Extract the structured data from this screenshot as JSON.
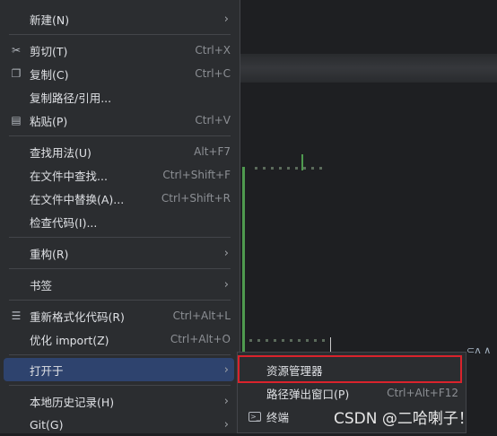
{
  "menu": {
    "items": [
      {
        "label": "新建(N)",
        "shortcut": "",
        "icon": "",
        "submenu": true
      },
      {
        "label": "剪切(T)",
        "shortcut": "Ctrl+X",
        "icon": "scissors-icon"
      },
      {
        "label": "复制(C)",
        "shortcut": "Ctrl+C",
        "icon": "copy-icon"
      },
      {
        "label": "复制路径/引用...",
        "shortcut": "",
        "icon": ""
      },
      {
        "label": "粘贴(P)",
        "shortcut": "Ctrl+V",
        "icon": "clipboard-icon"
      },
      {
        "label": "查找用法(U)",
        "shortcut": "Alt+F7",
        "icon": ""
      },
      {
        "label": "在文件中查找...",
        "shortcut": "Ctrl+Shift+F",
        "icon": ""
      },
      {
        "label": "在文件中替换(A)...",
        "shortcut": "Ctrl+Shift+R",
        "icon": ""
      },
      {
        "label": "检查代码(I)...",
        "shortcut": "",
        "icon": ""
      },
      {
        "label": "重构(R)",
        "shortcut": "",
        "icon": "",
        "submenu": true
      },
      {
        "label": "书签",
        "shortcut": "",
        "icon": "",
        "submenu": true
      },
      {
        "label": "重新格式化代码(R)",
        "shortcut": "Ctrl+Alt+L",
        "icon": "reformat-icon"
      },
      {
        "label": "优化 import(Z)",
        "shortcut": "Ctrl+Alt+O",
        "icon": ""
      },
      {
        "label": "打开于",
        "shortcut": "",
        "icon": "",
        "submenu": true,
        "selected": true
      },
      {
        "label": "本地历史记录(H)",
        "shortcut": "",
        "icon": "",
        "submenu": true
      },
      {
        "label": "Git(G)",
        "shortcut": "",
        "icon": "",
        "submenu": true
      }
    ]
  },
  "submenu": {
    "items": [
      {
        "label": "资源管理器",
        "shortcut": ""
      },
      {
        "label": "路径弹出窗口(P)",
        "shortcut": "Ctrl+Alt+F12"
      },
      {
        "label": "终端",
        "shortcut": "",
        "icon": "terminal-icon"
      }
    ]
  },
  "watermark": "CSDN @二哈喇子！",
  "side_text": "⊂ʌ ∧",
  "colors": {
    "menu_bg": "#2b2d30",
    "selected_bg": "#2e436e",
    "highlight_border": "#d9232c"
  }
}
